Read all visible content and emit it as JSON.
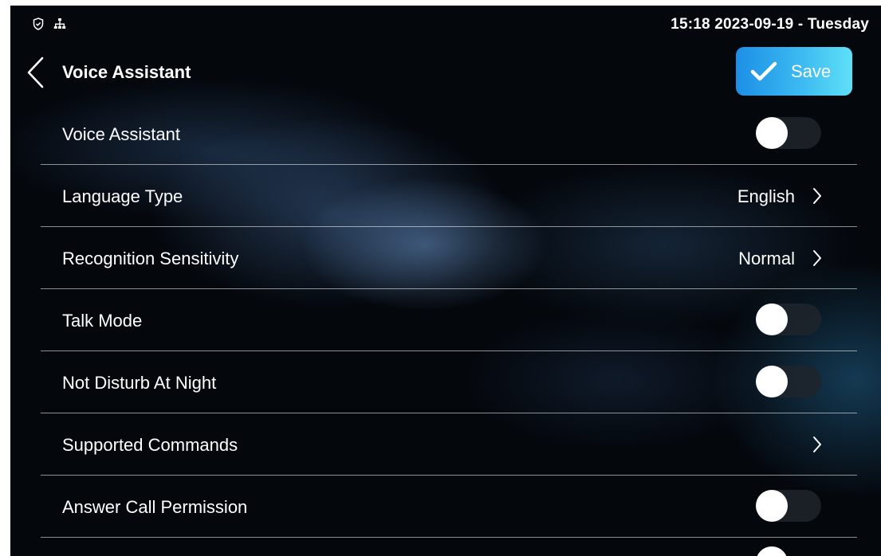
{
  "status_bar": {
    "datetime": "15:18  2023-09-19 - Tuesday",
    "icons": [
      "shield-icon",
      "network-icon"
    ]
  },
  "header": {
    "title": "Voice Assistant",
    "save_label": "Save"
  },
  "settings": [
    {
      "label": "Voice Assistant",
      "control": "toggle",
      "on": false
    },
    {
      "label": "Language Type",
      "control": "select",
      "value": "English"
    },
    {
      "label": "Recognition Sensitivity",
      "control": "select",
      "value": "Normal"
    },
    {
      "label": "Talk Mode",
      "control": "toggle",
      "on": false
    },
    {
      "label": "Not Disturb At Night",
      "control": "toggle",
      "on": false
    },
    {
      "label": "Supported Commands",
      "control": "link",
      "value": ""
    },
    {
      "label": "Answer Call Permission",
      "control": "toggle",
      "on": false
    }
  ],
  "colors": {
    "background": "#04070c",
    "save_gradient_start": "#1c8fe6",
    "save_gradient_end": "#5fe0f6",
    "toggle_track_off": "#1e242c",
    "text": "#ffffff"
  }
}
